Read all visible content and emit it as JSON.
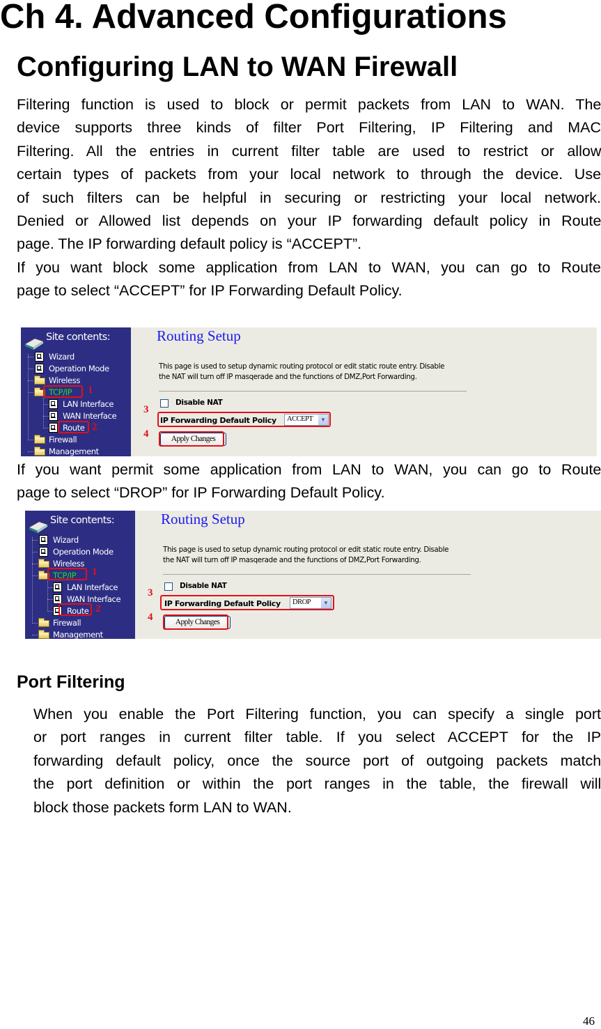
{
  "page": {
    "chapter_title": "Ch 4. Advanced Configurations",
    "section_title": "Configuring LAN to WAN Firewall",
    "intro_lines": [
      "Filtering function is used to block or permit packets from LAN to WAN. The",
      "device supports three kinds of filter Port Filtering, IP Filtering and MAC",
      "Filtering. All the entries in current filter table are used to restrict or allow",
      "certain types of packets from your local network to through the device. Use",
      "of such filters can be helpful in securing or restricting your local network.",
      "Denied or Allowed list depends on your IP forwarding default policy in Route",
      "page. The IP forwarding default policy is “ACCEPT”."
    ],
    "block_lines": [
      "If you want block some application from LAN to WAN, you can go to Route",
      "page to select “ACCEPT” for IP Forwarding Default Policy."
    ],
    "permit_lines": [
      "If you want permit some application from LAN to WAN, you can go to Route",
      "page to select “DROP” for IP Forwarding Default Policy."
    ],
    "port_filtering": {
      "title": "Port Filtering",
      "lines": [
        "When you enable the Port Filtering function, you can specify a single port",
        "or port ranges in current filter table. If you select ACCEPT for the IP",
        "forwarding default policy, once the source port of outgoing packets match",
        "the port definition or within the port ranges in the table, the firewall will",
        "block those packets form LAN to WAN."
      ]
    },
    "page_number": "46"
  },
  "screenshots": [
    {
      "sidebar": {
        "header": "Site contents:",
        "items": [
          "Wizard",
          "Operation Mode",
          "Wireless",
          "TCP/IP",
          "LAN Interface",
          "WAN Interface",
          "Route",
          "Firewall",
          "Management"
        ]
      },
      "routing": {
        "title": "Routing Setup",
        "desc_line1": "This page is used to setup dynamic routing protocol or edit static route entry. Disable",
        "desc_line2": "the NAT will turn off IP masqerade and the functions of DMZ,Port Forwarding.",
        "disable_nat_label": "Disable NAT",
        "disable_nat_checked": false,
        "policy_label": "IP Forwarding Default Policy",
        "policy_value": "ACCEPT",
        "apply_label": "Apply Changes"
      },
      "markers": [
        "1",
        "2",
        "3",
        "4"
      ]
    },
    {
      "sidebar": {
        "header": "Site contents:",
        "items": [
          "Wizard",
          "Operation Mode",
          "Wireless",
          "TCP/IP",
          "LAN Interface",
          "WAN Interface",
          "Route",
          "Firewall",
          "Management"
        ]
      },
      "routing": {
        "title": "Routing Setup",
        "desc_line1": "This page is used to setup dynamic routing protocol or edit static route entry. Disable",
        "desc_line2": "the NAT will turn off IP masqerade and the functions of DMZ,Port Forwarding.",
        "disable_nat_label": "Disable NAT",
        "disable_nat_checked": false,
        "policy_label": "IP Forwarding Default Policy",
        "policy_value": "DROP",
        "apply_label": "Apply Changes"
      },
      "markers": [
        "1",
        "2",
        "3",
        "4"
      ]
    }
  ],
  "colors": {
    "sidebar_bg": "#2d2e83",
    "active_item": "#22dd22",
    "highlight": "#e0101a",
    "title_blue": "#1a1aee",
    "content_bg": "#ecebe3"
  }
}
